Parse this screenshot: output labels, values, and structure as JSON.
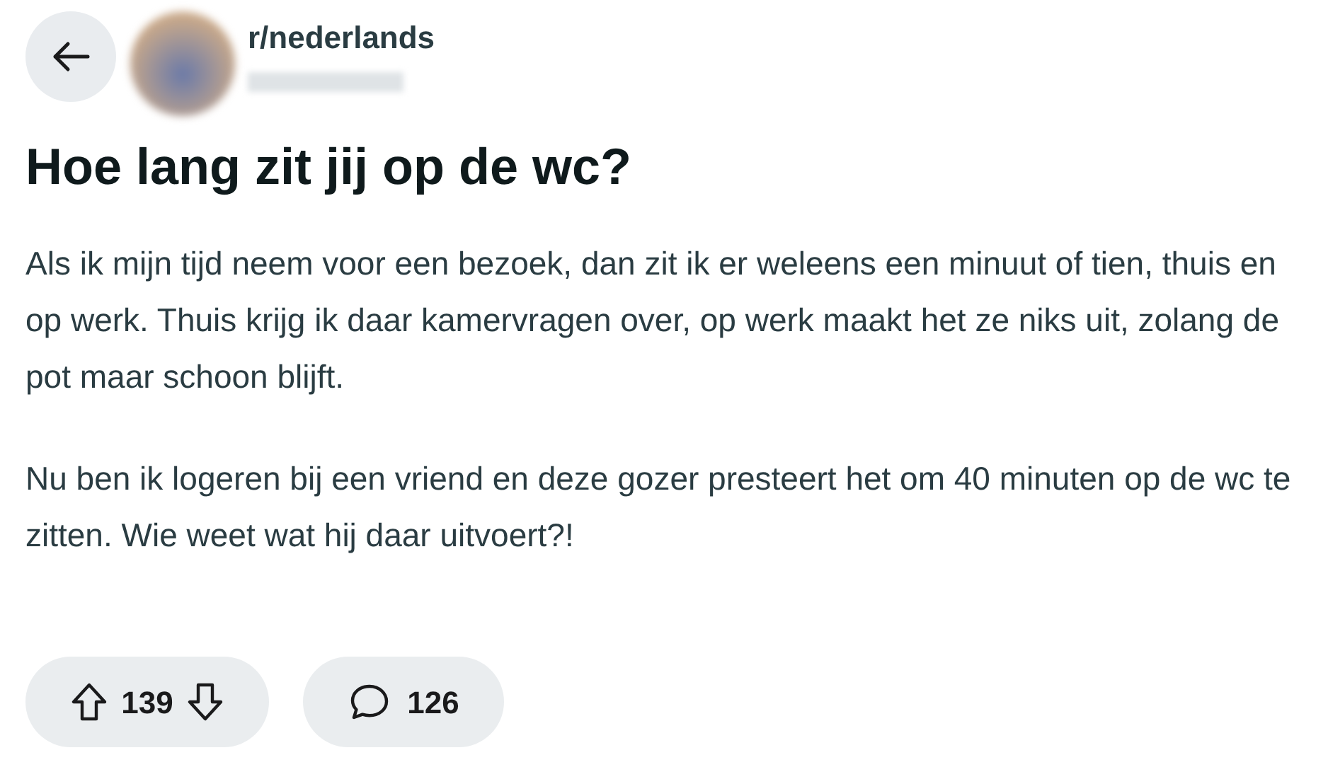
{
  "header": {
    "subreddit": "r/nederlands"
  },
  "post": {
    "title": "Hoe lang zit jij op de wc?",
    "paragraphs": [
      "Als ik mijn tijd neem voor een bezoek, dan zit ik er weleens een minuut of tien, thuis en op werk. Thuis krijg ik daar kamervragen over, op werk maakt het ze niks uit, zolang de pot maar schoon blijft.",
      "Nu ben ik logeren bij een vriend en deze gozer presteert het om 40 minuten op de wc te zitten. Wie weet wat hij daar uitvoert?!"
    ]
  },
  "actions": {
    "votes": "139",
    "comments": "126"
  }
}
